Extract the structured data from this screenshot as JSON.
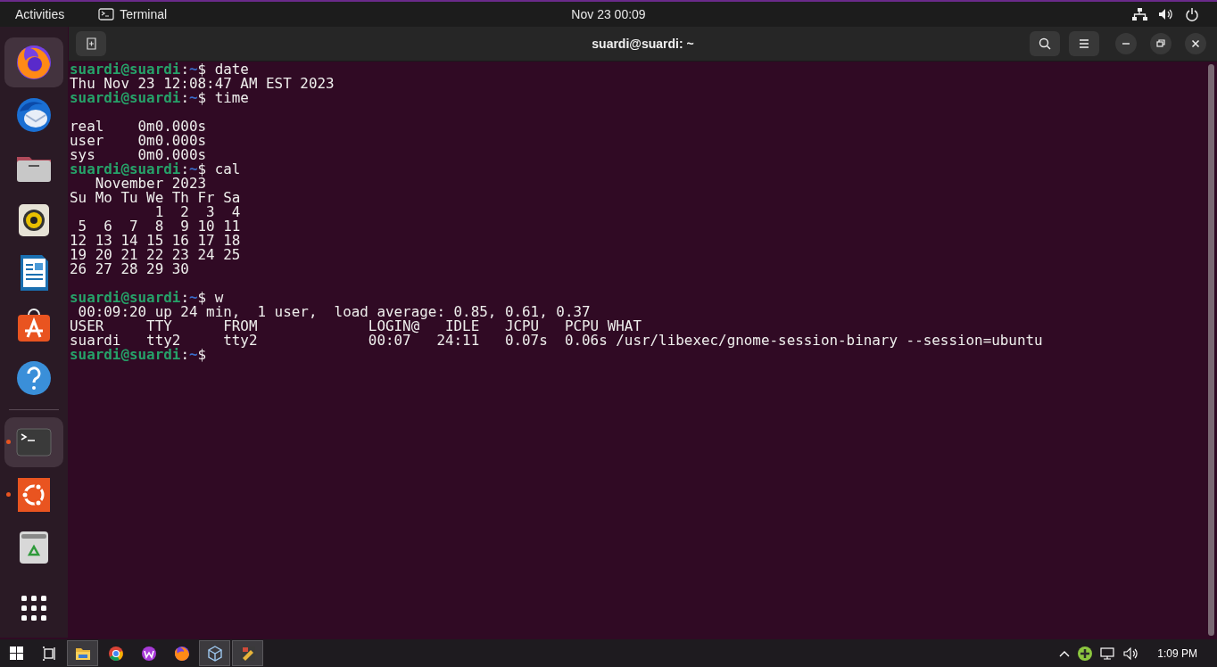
{
  "top_bar": {
    "activities": "Activities",
    "app_name": "Terminal",
    "clock": "Nov 23  00:09"
  },
  "dock": {
    "items": [
      {
        "kind": "fox-globe",
        "highlighted": true,
        "running": false
      },
      {
        "kind": "bird-mail",
        "highlighted": false,
        "running": false
      },
      {
        "kind": "folder",
        "highlighted": false,
        "running": false
      },
      {
        "kind": "speaker",
        "highlighted": false,
        "running": false
      },
      {
        "kind": "document",
        "highlighted": false,
        "running": false
      },
      {
        "kind": "bag",
        "highlighted": false,
        "running": false
      },
      {
        "kind": "help",
        "highlighted": false,
        "running": false
      },
      {
        "kind": "separator"
      },
      {
        "kind": "terminal",
        "highlighted": true,
        "running": true
      },
      {
        "kind": "ubuntu-logo",
        "highlighted": false,
        "running": true
      },
      {
        "kind": "trash",
        "highlighted": false,
        "running": false
      },
      {
        "kind": "grid",
        "highlighted": false,
        "running": false
      }
    ]
  },
  "terminal": {
    "title": "suardi@suardi: ~",
    "lines": [
      {
        "kind": "prompt",
        "user_host": "suardi@suardi",
        "colon": ":",
        "path": "~",
        "symbol": "$",
        "command": "date"
      },
      {
        "kind": "output",
        "text": "Thu Nov 23 12:08:47 AM EST 2023"
      },
      {
        "kind": "prompt",
        "user_host": "suardi@suardi",
        "colon": ":",
        "path": "~",
        "symbol": "$",
        "command": "time"
      },
      {
        "kind": "blank"
      },
      {
        "kind": "output",
        "text": "real    0m0.000s"
      },
      {
        "kind": "output",
        "text": "user    0m0.000s"
      },
      {
        "kind": "output",
        "text": "sys     0m0.000s"
      },
      {
        "kind": "prompt",
        "user_host": "suardi@suardi",
        "colon": ":",
        "path": "~",
        "symbol": "$",
        "command": "cal"
      },
      {
        "kind": "output",
        "text": "   November 2023"
      },
      {
        "kind": "output",
        "text": "Su Mo Tu We Th Fr Sa"
      },
      {
        "kind": "output",
        "text": "          1  2  3  4"
      },
      {
        "kind": "output",
        "text": " 5  6  7  8  9 10 11"
      },
      {
        "kind": "output",
        "text": "12 13 14 15 16 17 18"
      },
      {
        "kind": "output",
        "text": "19 20 21 22 23 24 25"
      },
      {
        "kind": "output",
        "text": "26 27 28 29 30"
      },
      {
        "kind": "blank"
      },
      {
        "kind": "prompt",
        "user_host": "suardi@suardi",
        "colon": ":",
        "path": "~",
        "symbol": "$",
        "command": "w"
      },
      {
        "kind": "output",
        "text": " 00:09:20 up 24 min,  1 user,  load average: 0.85, 0.61, 0.37"
      },
      {
        "kind": "output",
        "text": "USER     TTY      FROM             LOGIN@   IDLE   JCPU   PCPU WHAT"
      },
      {
        "kind": "output",
        "text": "suardi   tty2     tty2             00:07   24:11   0.07s  0.06s /usr/libexec/gnome-session-binary --session=ubuntu"
      },
      {
        "kind": "prompt",
        "user_host": "suardi@suardi",
        "colon": ":",
        "path": "~",
        "symbol": "$"
      }
    ]
  },
  "taskbar": {
    "items": [
      {
        "kind": "windows-logo",
        "highlighted": false
      },
      {
        "kind": "task-view",
        "highlighted": false
      },
      {
        "kind": "folder",
        "highlighted": true
      },
      {
        "kind": "round-browser",
        "highlighted": false
      },
      {
        "kind": "w-logo",
        "highlighted": false
      },
      {
        "kind": "fox-globe",
        "highlighted": false
      },
      {
        "kind": "cube",
        "highlighted": true
      },
      {
        "kind": "app-tile",
        "highlighted": true
      }
    ],
    "clock": "1:09 PM"
  }
}
